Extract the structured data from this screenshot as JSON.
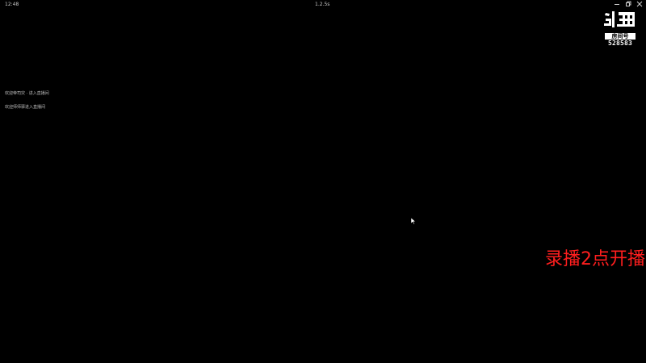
{
  "titlebar": {
    "clock": "12:48",
    "title": "1.2.5s",
    "buttons": [
      "minimize",
      "restore",
      "close"
    ]
  },
  "watermark": {
    "logo_text": "斗鱼",
    "room_label": "房间号",
    "room_number": "528583"
  },
  "chat": {
    "messages": [
      "欢迎帝司灾 · 进入直播间",
      "欢迎师师驿进入直播间"
    ]
  },
  "overlay": {
    "banner_text": "录播2点开播",
    "banner_color": "#ff1e1e"
  }
}
